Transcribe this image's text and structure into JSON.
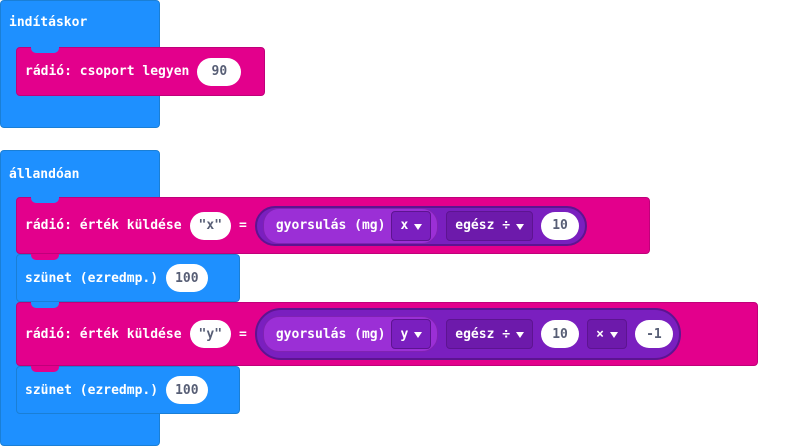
{
  "on_start": {
    "title": "indításkor",
    "group_block": {
      "label": "rádió: csoport legyen",
      "value": "90"
    }
  },
  "forever": {
    "title": "állandóan",
    "send_x": {
      "label": "rádió: érték küldése",
      "name": "\"x\"",
      "equals": "=",
      "accel_label": "gyorsulás (mg)",
      "axis": "x",
      "op": "egész ÷",
      "divisor": "10"
    },
    "pause1": {
      "label": "szünet (ezredmp.)",
      "value": "100"
    },
    "send_y": {
      "label": "rádió: érték küldése",
      "name": "\"y\"",
      "equals": "=",
      "accel_label": "gyorsulás (mg)",
      "axis": "y",
      "op": "egész ÷",
      "divisor": "10",
      "op2": "×",
      "multiplier": "-1"
    },
    "pause2": {
      "label": "szünet (ezredmp.)",
      "value": "100"
    }
  },
  "colors": {
    "basic": "#1e90ff",
    "radio": "#e3008c",
    "input": "#7a1fbf",
    "input_inner": "#9b2fd6"
  }
}
